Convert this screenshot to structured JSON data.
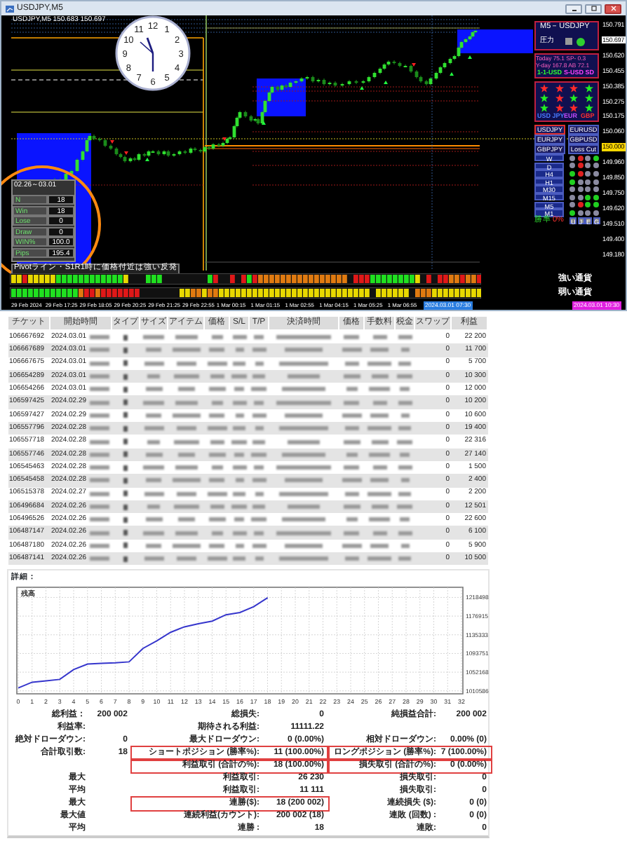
{
  "window": {
    "title": "USDJPY,M5"
  },
  "chart": {
    "header": "USDJPY,M5 150.683 150.697",
    "clock": {
      "numerals": [
        "11",
        "12",
        "1",
        "10",
        "2",
        "9",
        "3",
        "8",
        "4",
        "7",
        "5",
        "6"
      ]
    },
    "price_labels": [
      {
        "text": "150.791",
        "kind": "plain"
      },
      {
        "text": "150.697",
        "kind": "current"
      },
      {
        "text": "150.620",
        "kind": "plain"
      },
      {
        "text": "150.455",
        "kind": "plain"
      },
      {
        "text": "150.385",
        "kind": "plain"
      },
      {
        "text": "150.275",
        "kind": "plain"
      },
      {
        "text": "150.175",
        "kind": "plain"
      },
      {
        "text": "150.060",
        "kind": "plain"
      },
      {
        "text": "150.000",
        "kind": "line"
      },
      {
        "text": "149.960",
        "kind": "plain"
      },
      {
        "text": "149.850",
        "kind": "plain"
      },
      {
        "text": "149.750",
        "kind": "plain"
      },
      {
        "text": "149.620",
        "kind": "plain"
      },
      {
        "text": "149.510",
        "kind": "plain"
      },
      {
        "text": "149.400",
        "kind": "plain"
      },
      {
        "text": "149.180",
        "kind": "plain"
      }
    ],
    "signal_panel": {
      "title": "M5－USDJPY",
      "pressure_label": "圧力",
      "today": "Today 75.1 SP- 0.3",
      "yesterday": "Y-day 167.8 AB 72.1",
      "footer": [
        {
          "text": "1-1-USD",
          "color": "#30ff30"
        },
        {
          "text": "S-USD SD",
          "color": "#ff40ff"
        }
      ]
    },
    "star_rows": [
      {
        "items": [
          {
            "color": "#ff2a2a"
          },
          {
            "color": "#ff2a2a"
          },
          {
            "color": "#ff2a2a"
          },
          {
            "color": "#22ee22"
          }
        ]
      },
      {
        "items": [
          {
            "color": "#22ee22"
          },
          {
            "color": "#ff2a2a"
          },
          {
            "color": "#22ee22"
          },
          {
            "color": "#22ee22"
          }
        ]
      },
      {
        "items": [
          {
            "color": "#22ee22"
          },
          {
            "color": "#ff2a2a"
          },
          {
            "color": "#ff2a2a"
          },
          {
            "color": "#22ee22"
          }
        ]
      }
    ],
    "currencies": [
      {
        "text": "USD JPY",
        "color": "#4a7bff"
      },
      {
        "text": "EUR",
        "color": "#c24dff"
      },
      {
        "text": "GBP",
        "color": "#ff3030"
      }
    ],
    "pairs": [
      {
        "label": "USDJPY",
        "selected": true
      },
      {
        "label": "EURUSD",
        "selected": false
      },
      {
        "label": "EURJPY",
        "selected": false
      },
      {
        "label": "GBPUSD",
        "selected": false
      },
      {
        "label": "GBPJPY",
        "selected": false
      },
      {
        "label": "Loss Cut",
        "selected": false
      }
    ],
    "timeframes": [
      {
        "label": "W",
        "dots": [
          {
            "color": "#8a8aa0"
          },
          {
            "color": "#e02020"
          },
          {
            "color": "#8a8aa0"
          },
          {
            "color": "#20d020"
          }
        ]
      },
      {
        "label": "D",
        "dots": [
          {
            "color": "#8a8aa0"
          },
          {
            "color": "#e02020"
          },
          {
            "color": "#8a8aa0"
          },
          {
            "color": "#8a8aa0"
          }
        ]
      },
      {
        "label": "H4",
        "dots": [
          {
            "color": "#20d020"
          },
          {
            "color": "#e02020"
          },
          {
            "color": "#8a8aa0"
          },
          {
            "color": "#8a8aa0"
          }
        ]
      },
      {
        "label": "H1",
        "dots": [
          {
            "color": "#20d020"
          },
          {
            "color": "#8a8aa0"
          },
          {
            "color": "#8a8aa0"
          },
          {
            "color": "#8a8aa0"
          }
        ]
      },
      {
        "label": "M30",
        "dots": [
          {
            "color": "#8a8aa0"
          },
          {
            "color": "#8a8aa0"
          },
          {
            "color": "#8a8aa0"
          },
          {
            "color": "#8a8aa0"
          }
        ]
      },
      {
        "label": "M15",
        "dots": [
          {
            "color": "#8a8aa0"
          },
          {
            "color": "#8a8aa0"
          },
          {
            "color": "#20d020"
          },
          {
            "color": "#20d020"
          }
        ]
      },
      {
        "label": "M5",
        "dots": [
          {
            "color": "#8a8aa0"
          },
          {
            "color": "#e02020"
          },
          {
            "color": "#20d020"
          },
          {
            "color": "#20d020"
          }
        ]
      },
      {
        "label": "M1",
        "dots": [
          {
            "color": "#20d020"
          },
          {
            "color": "#8a8aa0"
          },
          {
            "color": "#8a8aa0"
          },
          {
            "color": "#8a8aa0"
          }
        ]
      }
    ],
    "win_label": "勝率",
    "win_value": "0%",
    "currency_keys": [
      "U",
      "J",
      "E",
      "G"
    ],
    "stats": {
      "period": "02.26～03.01",
      "rows": [
        {
          "label": "N",
          "value": "18"
        },
        {
          "label": "Win",
          "value": "18"
        },
        {
          "label": "Lose",
          "value": "0"
        },
        {
          "label": "Draw",
          "value": "0"
        },
        {
          "label": "WIN%",
          "value": "100.0"
        },
        {
          "label": "Pips",
          "value": "195.4"
        }
      ]
    },
    "note": "Pivotライン・S1R1時に価格付近は強い反発",
    "strength": [
      {
        "label": "強い通貨"
      },
      {
        "label": "弱い通貨"
      }
    ],
    "time_labels": [
      "29 Feb 2024",
      "29 Feb 17:25",
      "29 Feb 18:05",
      "29 Feb 20:25",
      "29 Feb 21:25",
      "29 Feb 22:55",
      "1 Mar 00:15",
      "1 Mar 01:15",
      "1 Mar 02:55",
      "1 Mar 04:15",
      "1 Mar 05:25",
      "1 Mar 06:55"
    ],
    "time_markers": [
      {
        "text": "2024.03.01 07:30",
        "color": "#2a7de0"
      },
      {
        "text": "2024.03.01 10:30",
        "color": "#e020e0"
      }
    ]
  },
  "trades": {
    "columns": [
      "チケット",
      "開始時間",
      "タイプ",
      "サイズ",
      "アイテム",
      "価格",
      "S/L",
      "T/P",
      "決済時間",
      "価格",
      "手数料",
      "税金",
      "スワップ",
      "利益"
    ],
    "rows": [
      {
        "ticket": "106667692",
        "date": "2024.03.01",
        "swap": "0",
        "profit": "22 200"
      },
      {
        "ticket": "106667689",
        "date": "2024.03.01",
        "swap": "0",
        "profit": "11 700"
      },
      {
        "ticket": "106667675",
        "date": "2024.03.01",
        "swap": "0",
        "profit": "5 700"
      },
      {
        "ticket": "106654289",
        "date": "2024.03.01",
        "swap": "0",
        "profit": "10 300"
      },
      {
        "ticket": "106654266",
        "date": "2024.03.01",
        "swap": "0",
        "profit": "12 000"
      },
      {
        "ticket": "106597425",
        "date": "2024.02.29",
        "swap": "0",
        "profit": "10 200"
      },
      {
        "ticket": "106597427",
        "date": "2024.02.29",
        "swap": "0",
        "profit": "10 600"
      },
      {
        "ticket": "106557796",
        "date": "2024.02.28",
        "swap": "0",
        "profit": "19 400"
      },
      {
        "ticket": "106557718",
        "date": "2024.02.28",
        "swap": "0",
        "profit": "22 316"
      },
      {
        "ticket": "106557746",
        "date": "2024.02.28",
        "swap": "0",
        "profit": "27 140"
      },
      {
        "ticket": "106545463",
        "date": "2024.02.28",
        "swap": "0",
        "profit": "1 500"
      },
      {
        "ticket": "106545458",
        "date": "2024.02.28",
        "swap": "0",
        "profit": "2 400"
      },
      {
        "ticket": "106515378",
        "date": "2024.02.27",
        "swap": "0",
        "profit": "2 200"
      },
      {
        "ticket": "106496684",
        "date": "2024.02.26",
        "swap": "0",
        "profit": "12 501"
      },
      {
        "ticket": "106496526",
        "date": "2024.02.26",
        "swap": "0",
        "profit": "22 600"
      },
      {
        "ticket": "106487147",
        "date": "2024.02.26",
        "swap": "0",
        "profit": "6 100"
      },
      {
        "ticket": "106487180",
        "date": "2024.02.26",
        "swap": "0",
        "profit": "5 900"
      },
      {
        "ticket": "106487141",
        "date": "2024.02.26",
        "swap": "0",
        "profit": "10 500"
      }
    ]
  },
  "report": {
    "title": "詳細：",
    "chart_data": {
      "type": "line",
      "x": [
        0,
        1,
        2,
        3,
        4,
        5,
        6,
        7,
        8,
        9,
        10,
        11,
        12,
        13,
        14,
        15,
        16,
        17,
        18
      ],
      "series": [
        {
          "name": "残高",
          "color": "#3535cc",
          "values": [
            1017000,
            1030000,
            1033000,
            1036000,
            1058000,
            1070000,
            1072000,
            1073000,
            1075000,
            1105000,
            1122000,
            1141000,
            1153000,
            1160000,
            1166000,
            1180000,
            1185000,
            1198000,
            1218000
          ]
        }
      ],
      "xlim": [
        0,
        32
      ],
      "ylim": [
        1004000,
        1241000
      ],
      "grid": true,
      "xticks": [
        0,
        1,
        2,
        3,
        4,
        5,
        6,
        7,
        8,
        9,
        10,
        11,
        12,
        13,
        14,
        15,
        16,
        17,
        18,
        19,
        20,
        21,
        22,
        23,
        24,
        25,
        26,
        27,
        28,
        29,
        30,
        31,
        32
      ],
      "yticks": [
        1010586,
        1052168,
        1093751,
        1135333,
        1176915,
        1218498
      ]
    },
    "stats": [
      {
        "cells": [
          {
            "label": "総利益：",
            "value": "200 002",
            "highlighted": false
          },
          {
            "label": "総損失:",
            "value": "0",
            "highlighted": false
          },
          {
            "label": "純損益合計:",
            "value": "200 002",
            "highlighted": false
          }
        ]
      },
      {
        "cells": [
          {
            "label": "利益率:",
            "highlighted": false
          },
          {
            "label": "期待される利益:",
            "value": "11111.22",
            "highlighted": false
          }
        ]
      },
      {
        "cells": [
          {
            "label": "絶対ドローダウン:",
            "value": "0",
            "highlighted": false
          },
          {
            "label": "最大ドローダウン:",
            "value": "0 (0.00%)",
            "highlighted": false
          },
          {
            "label": "相対ドローダウン:",
            "value": "0.00% (0)",
            "highlighted": false
          }
        ]
      },
      {
        "cells": [
          {
            "label": "合計取引数:",
            "value": "18",
            "highlighted": false
          },
          {
            "label": "ショートポジション (勝率%):",
            "value": "11 (100.00%)",
            "highlighted": true
          },
          {
            "label": "ロングポジション (勝率%):",
            "value": "7 (100.00%)",
            "highlighted": true
          }
        ]
      },
      {
        "cells": [
          {
            "highlighted": false
          },
          {
            "label": "利益取引 (合計の%):",
            "value": "18 (100.00%)",
            "highlighted": true
          },
          {
            "label": "損失取引 (合計の%):",
            "value": "0 (0.00%)",
            "highlighted": true
          }
        ]
      },
      {
        "cells": [
          {
            "label": "最大",
            "highlighted": false
          },
          {
            "label": "利益取引:",
            "value": "26 230",
            "highlighted": false
          },
          {
            "label": "損失取引:",
            "value": "0",
            "highlighted": false
          }
        ]
      },
      {
        "cells": [
          {
            "label": "平均",
            "highlighted": false
          },
          {
            "label": "利益取引:",
            "value": "11 111",
            "highlighted": false
          },
          {
            "label": "損失取引:",
            "value": "0",
            "highlighted": false
          }
        ]
      },
      {
        "cells": [
          {
            "label": "最大",
            "highlighted": false
          },
          {
            "label": "連勝($):",
            "value": "18 (200 002)",
            "highlighted": true
          },
          {
            "label": "連続損失 ($):",
            "value": "0 (0)",
            "highlighted": false
          }
        ]
      },
      {
        "cells": [
          {
            "label": "最大値",
            "highlighted": false
          },
          {
            "label": "連続利益(カウント):",
            "value": "200 002 (18)",
            "highlighted": false
          },
          {
            "label": "連敗 (回数) :",
            "value": "0 (0)",
            "highlighted": false
          }
        ]
      },
      {
        "cells": [
          {
            "label": "平均",
            "highlighted": false
          },
          {
            "label": "連勝 :",
            "value": "18",
            "highlighted": false
          },
          {
            "label": "連敗:",
            "value": "0",
            "highlighted": false
          }
        ]
      }
    ]
  }
}
